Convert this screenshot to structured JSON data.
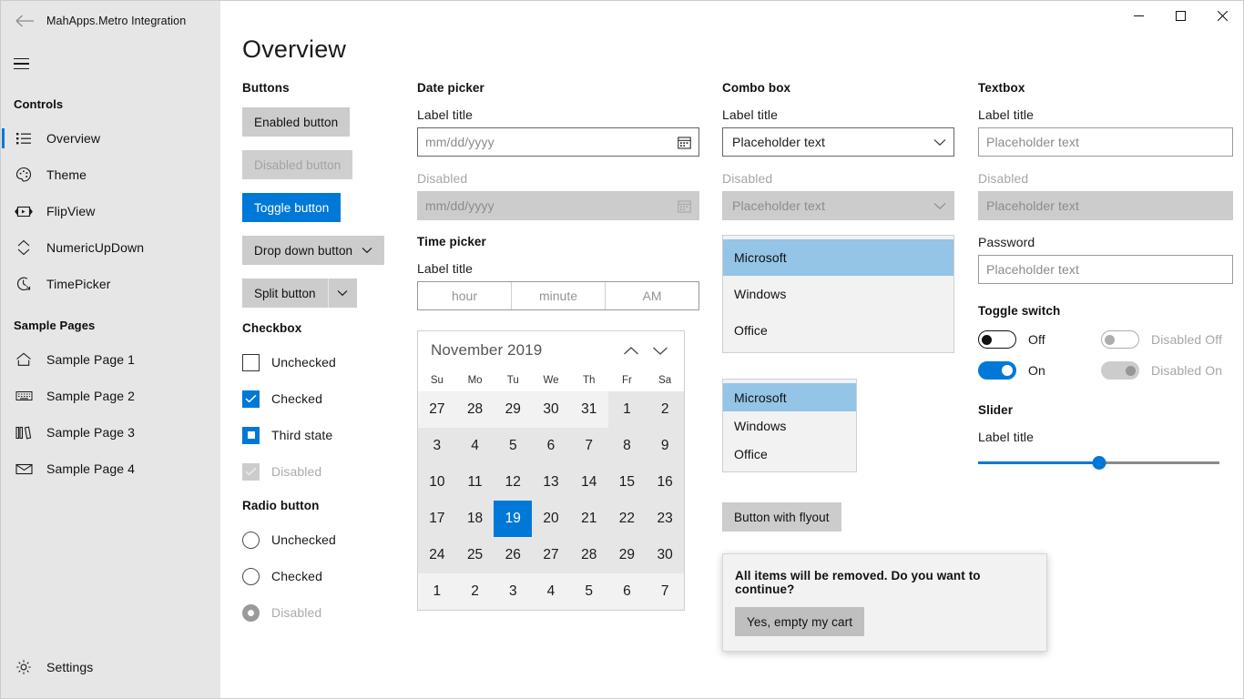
{
  "window": {
    "title": "MahApps.Metro Integration",
    "back_icon": "back-arrow-icon",
    "menu_icon": "hamburger-icon",
    "minimize": "—",
    "maximize": "☐",
    "close": "✕"
  },
  "sidebar": {
    "sections": [
      {
        "title": "Controls",
        "items": [
          {
            "label": "Overview",
            "icon": "list-icon",
            "selected": true
          },
          {
            "label": "Theme",
            "icon": "palette-icon",
            "selected": false
          },
          {
            "label": "FlipView",
            "icon": "flipview-icon",
            "selected": false
          },
          {
            "label": "NumericUpDown",
            "icon": "updown-icon",
            "selected": false
          },
          {
            "label": "TimePicker",
            "icon": "clock-icon",
            "selected": false
          }
        ]
      },
      {
        "title": "Sample Pages",
        "items": [
          {
            "label": "Sample Page 1",
            "icon": "home-icon",
            "selected": false
          },
          {
            "label": "Sample Page 2",
            "icon": "keyboard-icon",
            "selected": false
          },
          {
            "label": "Sample Page 3",
            "icon": "library-icon",
            "selected": false
          },
          {
            "label": "Sample Page 4",
            "icon": "mail-icon",
            "selected": false
          }
        ]
      }
    ],
    "settings": {
      "label": "Settings",
      "icon": "gear-icon"
    }
  },
  "page": {
    "title": "Overview"
  },
  "buttons": {
    "heading": "Buttons",
    "enabled": "Enabled button",
    "disabled": "Disabled button",
    "toggle": "Toggle button",
    "dropdown": "Drop down button",
    "split": "Split button"
  },
  "checkbox": {
    "heading": "Checkbox",
    "unchecked": "Unchecked",
    "checked": "Checked",
    "third": "Third state",
    "disabled": "Disabled"
  },
  "radio": {
    "heading": "Radio button",
    "unchecked": "Unchecked",
    "checked": "Checked",
    "disabled": "Disabled"
  },
  "datepicker": {
    "heading": "Date picker",
    "label": "Label title",
    "placeholder": "mm/dd/yyyy",
    "disabled_label": "Disabled",
    "disabled_placeholder": "mm/dd/yyyy"
  },
  "timepicker": {
    "heading": "Time picker",
    "label": "Label title",
    "hour": "hour",
    "minute": "minute",
    "meridiem": "AM"
  },
  "calendar": {
    "month": "November 2019",
    "prev_icon": "chevron-up-icon",
    "next_icon": "chevron-down-icon",
    "dows": [
      "Su",
      "Mo",
      "Tu",
      "We",
      "Th",
      "Fr",
      "Sa"
    ],
    "selected_day": 19,
    "weeks": [
      [
        {
          "d": "27",
          "o": true
        },
        {
          "d": "28",
          "o": true
        },
        {
          "d": "29",
          "o": true
        },
        {
          "d": "30",
          "o": true
        },
        {
          "d": "31",
          "o": true
        },
        {
          "d": "1",
          "o": false
        },
        {
          "d": "2",
          "o": false
        }
      ],
      [
        {
          "d": "3",
          "o": false
        },
        {
          "d": "4",
          "o": false
        },
        {
          "d": "5",
          "o": false
        },
        {
          "d": "6",
          "o": false
        },
        {
          "d": "7",
          "o": false
        },
        {
          "d": "8",
          "o": false
        },
        {
          "d": "9",
          "o": false
        }
      ],
      [
        {
          "d": "10",
          "o": false
        },
        {
          "d": "11",
          "o": false
        },
        {
          "d": "12",
          "o": false
        },
        {
          "d": "13",
          "o": false
        },
        {
          "d": "14",
          "o": false
        },
        {
          "d": "15",
          "o": false
        },
        {
          "d": "16",
          "o": false
        }
      ],
      [
        {
          "d": "17",
          "o": false
        },
        {
          "d": "18",
          "o": false
        },
        {
          "d": "19",
          "o": false,
          "s": true
        },
        {
          "d": "20",
          "o": false
        },
        {
          "d": "21",
          "o": false
        },
        {
          "d": "22",
          "o": false
        },
        {
          "d": "23",
          "o": false
        }
      ],
      [
        {
          "d": "24",
          "o": false
        },
        {
          "d": "25",
          "o": false
        },
        {
          "d": "26",
          "o": false
        },
        {
          "d": "27",
          "o": false
        },
        {
          "d": "28",
          "o": false
        },
        {
          "d": "29",
          "o": false
        },
        {
          "d": "30",
          "o": false
        }
      ],
      [
        {
          "d": "1",
          "o": true
        },
        {
          "d": "2",
          "o": true
        },
        {
          "d": "3",
          "o": true
        },
        {
          "d": "4",
          "o": true
        },
        {
          "d": "5",
          "o": true
        },
        {
          "d": "6",
          "o": true
        },
        {
          "d": "7",
          "o": true
        }
      ]
    ]
  },
  "combobox": {
    "heading": "Combo box",
    "label": "Label title",
    "value": "Placeholder text",
    "disabled_label": "Disabled",
    "disabled_value": "Placeholder text",
    "list_big": [
      {
        "label": "Microsoft",
        "selected": true
      },
      {
        "label": "Windows",
        "selected": false
      },
      {
        "label": "Office",
        "selected": false
      }
    ],
    "list_small": [
      {
        "label": "Microsoft",
        "selected": true
      },
      {
        "label": "Windows",
        "selected": false
      },
      {
        "label": "Office",
        "selected": false
      }
    ]
  },
  "flyout": {
    "button": "Button with flyout",
    "message": "All items will be removed. Do you want to continue?",
    "confirm": "Yes, empty my cart"
  },
  "textbox": {
    "heading": "Textbox",
    "label": "Label title",
    "placeholder": "Placeholder text",
    "disabled_label": "Disabled",
    "disabled_placeholder": "Placeholder text",
    "password_label": "Password",
    "password_placeholder": "Placeholder text"
  },
  "toggleswitch": {
    "heading": "Toggle switch",
    "off": "Off",
    "on": "On",
    "disabled_off": "Disabled Off",
    "disabled_on": "Disabled On"
  },
  "slider": {
    "heading": "Slider",
    "label": "Label title",
    "value_percent": 50
  },
  "colors": {
    "accent": "#0078d7",
    "sidebar_bg": "#e6e6e6",
    "button_bg": "#cccccc",
    "list_selection": "#94c4e6",
    "calendar_bg": "#e6e6e6"
  }
}
